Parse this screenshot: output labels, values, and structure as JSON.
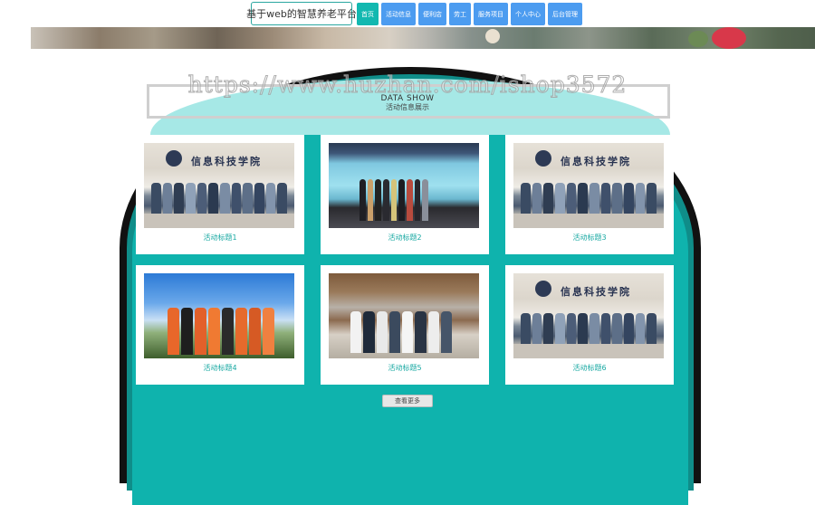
{
  "header": {
    "site_title": "基于web的智慧养老平台",
    "nav": [
      {
        "label": "首页",
        "active": true
      },
      {
        "label": "活动信息",
        "active": false
      },
      {
        "label": "便利店",
        "active": false
      },
      {
        "label": "劳工",
        "active": false
      },
      {
        "label": "服务项目",
        "active": false
      },
      {
        "label": "个人中心",
        "active": false
      },
      {
        "label": "后台管理",
        "active": false
      }
    ]
  },
  "section": {
    "title_en": "DATA SHOW",
    "title_cn": "活动信息展示",
    "watermark": "https://www.huzhan.com/ishop3572"
  },
  "cards": [
    {
      "title": "活动标题1",
      "photo": "group-photo"
    },
    {
      "title": "活动标题2",
      "photo": "stage-photo"
    },
    {
      "title": "活动标题3",
      "photo": "group-photo"
    },
    {
      "title": "活动标题4",
      "photo": "sky-photo"
    },
    {
      "title": "活动标题5",
      "photo": "gate-photo"
    },
    {
      "title": "活动标题6",
      "photo": "group-photo"
    }
  ],
  "more_button": "查看更多",
  "colors": {
    "accent": "#0fb3ad",
    "nav_blue": "#4c9cf0",
    "card_title": "#17a8a2"
  }
}
